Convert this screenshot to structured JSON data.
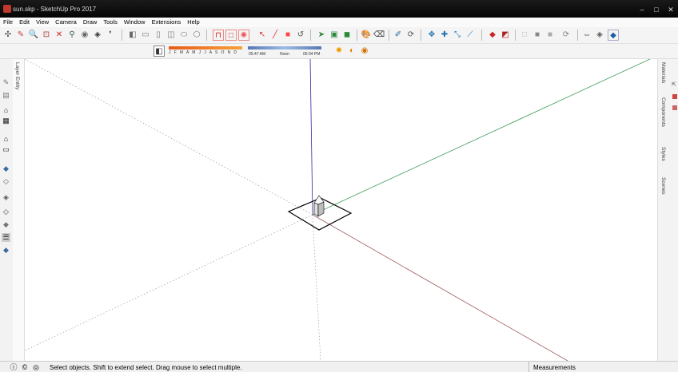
{
  "window": {
    "title": "sun.skp - SketchUp Pro 2017",
    "min": "–",
    "max": "□",
    "close": "✕"
  },
  "menu": [
    "File",
    "Edit",
    "View",
    "Camera",
    "Draw",
    "Tools",
    "Window",
    "Extensions",
    "Help"
  ],
  "shadows": {
    "months": "J F M A M J J A S O N D",
    "time_start": "05:47 AM",
    "time_mid": "Noon",
    "time_end": "06:04 PM"
  },
  "left_tray_label": "Layer Entity",
  "right_tabs": [
    "Materials",
    "Components",
    "Styles",
    "Scenes"
  ],
  "status": {
    "message": "Select objects. Shift to extend select. Drag mouse to select multiple.",
    "measurements_label": "Measurements"
  },
  "colors": {
    "red_axis": "#a05a5a",
    "green_axis": "#3d9a5a",
    "blue_axis": "#2a2aa0"
  }
}
